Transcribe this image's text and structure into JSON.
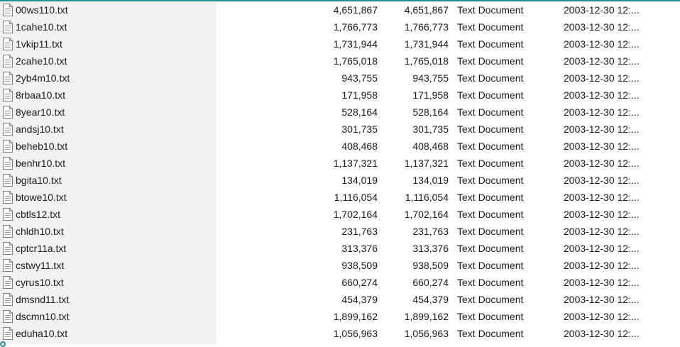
{
  "files": [
    {
      "name": "00ws110.txt",
      "size": "4,651,867",
      "size2": "4,651,867",
      "type": "Text Document",
      "date": "2003-12-30 12:..."
    },
    {
      "name": "1cahe10.txt",
      "size": "1,766,773",
      "size2": "1,766,773",
      "type": "Text Document",
      "date": "2003-12-30 12:..."
    },
    {
      "name": "1vkip11.txt",
      "size": "1,731,944",
      "size2": "1,731,944",
      "type": "Text Document",
      "date": "2003-12-30 12:..."
    },
    {
      "name": "2cahe10.txt",
      "size": "1,765,018",
      "size2": "1,765,018",
      "type": "Text Document",
      "date": "2003-12-30 12:..."
    },
    {
      "name": "2yb4m10.txt",
      "size": "943,755",
      "size2": "943,755",
      "type": "Text Document",
      "date": "2003-12-30 12:..."
    },
    {
      "name": "8rbaa10.txt",
      "size": "171,958",
      "size2": "171,958",
      "type": "Text Document",
      "date": "2003-12-30 12:..."
    },
    {
      "name": "8year10.txt",
      "size": "528,164",
      "size2": "528,164",
      "type": "Text Document",
      "date": "2003-12-30 12:..."
    },
    {
      "name": "andsj10.txt",
      "size": "301,735",
      "size2": "301,735",
      "type": "Text Document",
      "date": "2003-12-30 12:..."
    },
    {
      "name": "beheb10.txt",
      "size": "408,468",
      "size2": "408,468",
      "type": "Text Document",
      "date": "2003-12-30 12:..."
    },
    {
      "name": "benhr10.txt",
      "size": "1,137,321",
      "size2": "1,137,321",
      "type": "Text Document",
      "date": "2003-12-30 12:..."
    },
    {
      "name": "bgita10.txt",
      "size": "134,019",
      "size2": "134,019",
      "type": "Text Document",
      "date": "2003-12-30 12:..."
    },
    {
      "name": "btowe10.txt",
      "size": "1,116,054",
      "size2": "1,116,054",
      "type": "Text Document",
      "date": "2003-12-30 12:..."
    },
    {
      "name": "cbtls12.txt",
      "size": "1,702,164",
      "size2": "1,702,164",
      "type": "Text Document",
      "date": "2003-12-30 12:..."
    },
    {
      "name": "chldh10.txt",
      "size": "231,763",
      "size2": "231,763",
      "type": "Text Document",
      "date": "2003-12-30 12:..."
    },
    {
      "name": "cptcr11a.txt",
      "size": "313,376",
      "size2": "313,376",
      "type": "Text Document",
      "date": "2003-12-30 12:..."
    },
    {
      "name": "cstwy11.txt",
      "size": "938,509",
      "size2": "938,509",
      "type": "Text Document",
      "date": "2003-12-30 12:..."
    },
    {
      "name": "cyrus10.txt",
      "size": "660,274",
      "size2": "660,274",
      "type": "Text Document",
      "date": "2003-12-30 12:..."
    },
    {
      "name": "dmsnd11.txt",
      "size": "454,379",
      "size2": "454,379",
      "type": "Text Document",
      "date": "2003-12-30 12:..."
    },
    {
      "name": "dscmn10.txt",
      "size": "1,899,162",
      "size2": "1,899,162",
      "type": "Text Document",
      "date": "2003-12-30 12:..."
    },
    {
      "name": "eduha10.txt",
      "size": "1,056,963",
      "size2": "1,056,963",
      "type": "Text Document",
      "date": "2003-12-30 12:..."
    }
  ],
  "icons": {
    "file": "text-document-icon"
  },
  "colors": {
    "accent": "#2a8a95",
    "name_column_bg": "#f2f2f2"
  }
}
